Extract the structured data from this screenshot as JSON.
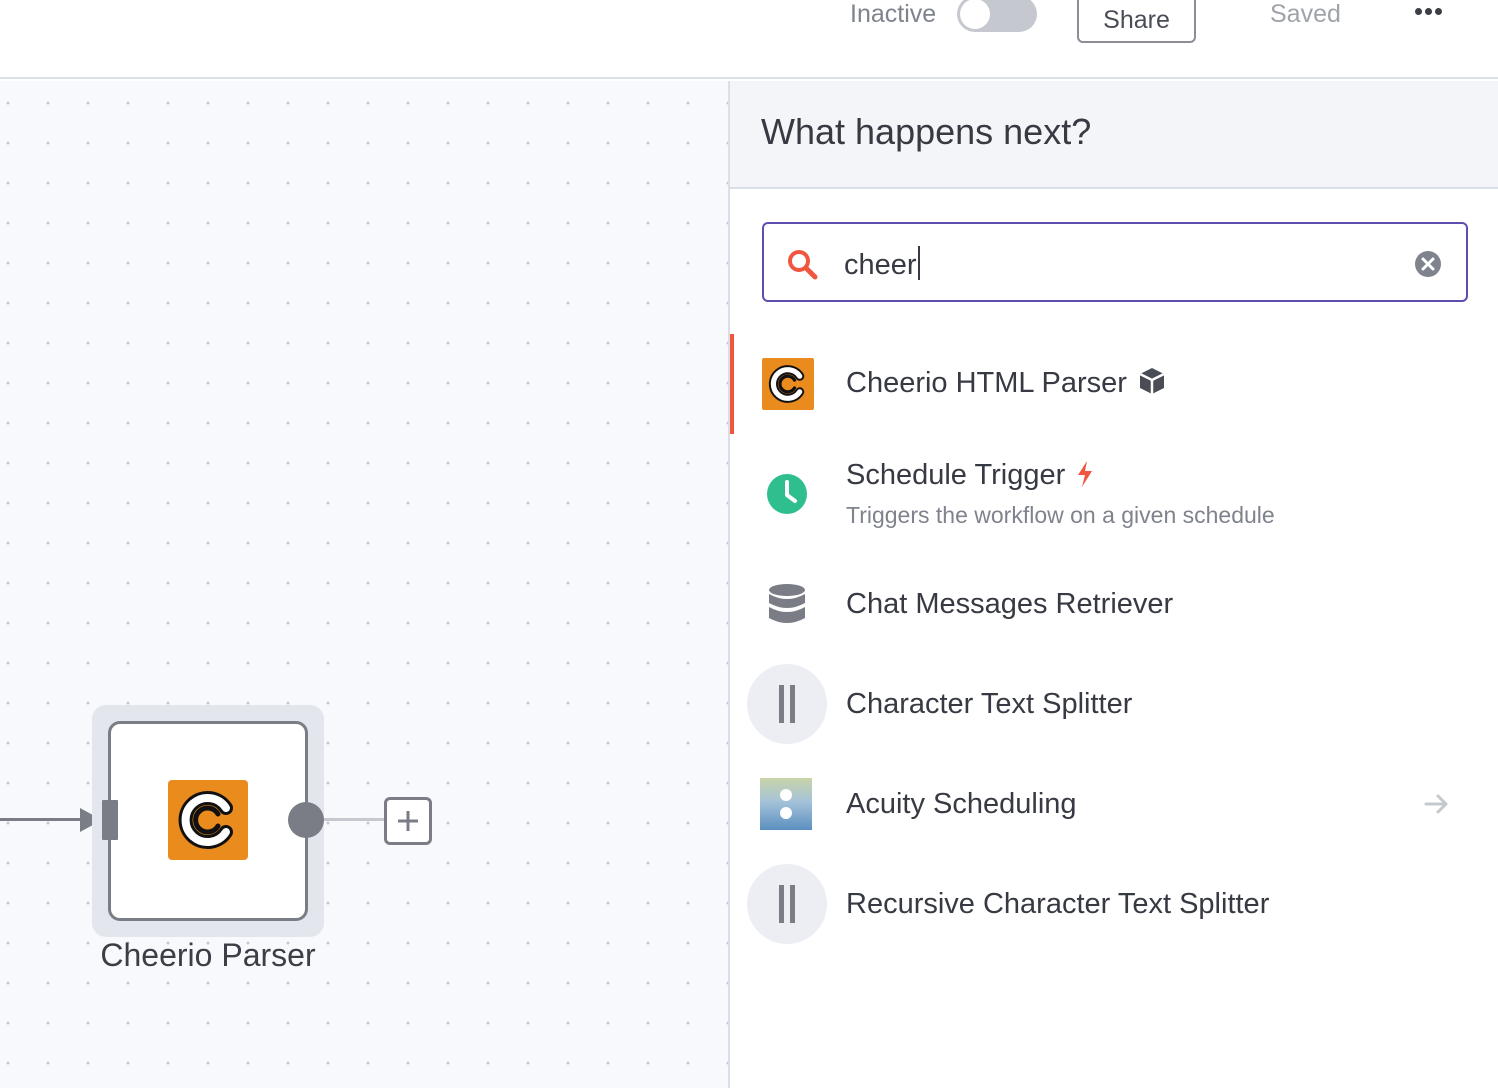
{
  "header": {
    "status_label": "Inactive",
    "share_label": "Share",
    "saved_label": "Saved"
  },
  "canvas": {
    "node": {
      "label": "Cheerio Parser",
      "icon": "cheerio-icon",
      "icon_color": "#ea8b1e"
    }
  },
  "panel": {
    "title": "What happens next?",
    "search": {
      "value": "cheer"
    },
    "results": [
      {
        "title": "Cheerio HTML Parser",
        "icon": "cheerio-icon",
        "badge": "cube-icon",
        "active": true
      },
      {
        "title": "Schedule Trigger",
        "description": "Triggers the workflow on a given schedule",
        "icon": "clock-icon",
        "badge": "lightning-icon"
      },
      {
        "title": "Chat Messages Retriever",
        "icon": "database-icon"
      },
      {
        "title": "Character Text Splitter",
        "icon": "splitter-icon"
      },
      {
        "title": "Acuity Scheduling",
        "icon": "acuity-icon",
        "trailing": "arrow-right-icon"
      },
      {
        "title": "Recursive Character Text Splitter",
        "icon": "splitter-icon"
      }
    ]
  },
  "colors": {
    "accent": "#f0553f",
    "search_border": "#5d4fb0",
    "schedule_green": "#2fbf8f"
  }
}
